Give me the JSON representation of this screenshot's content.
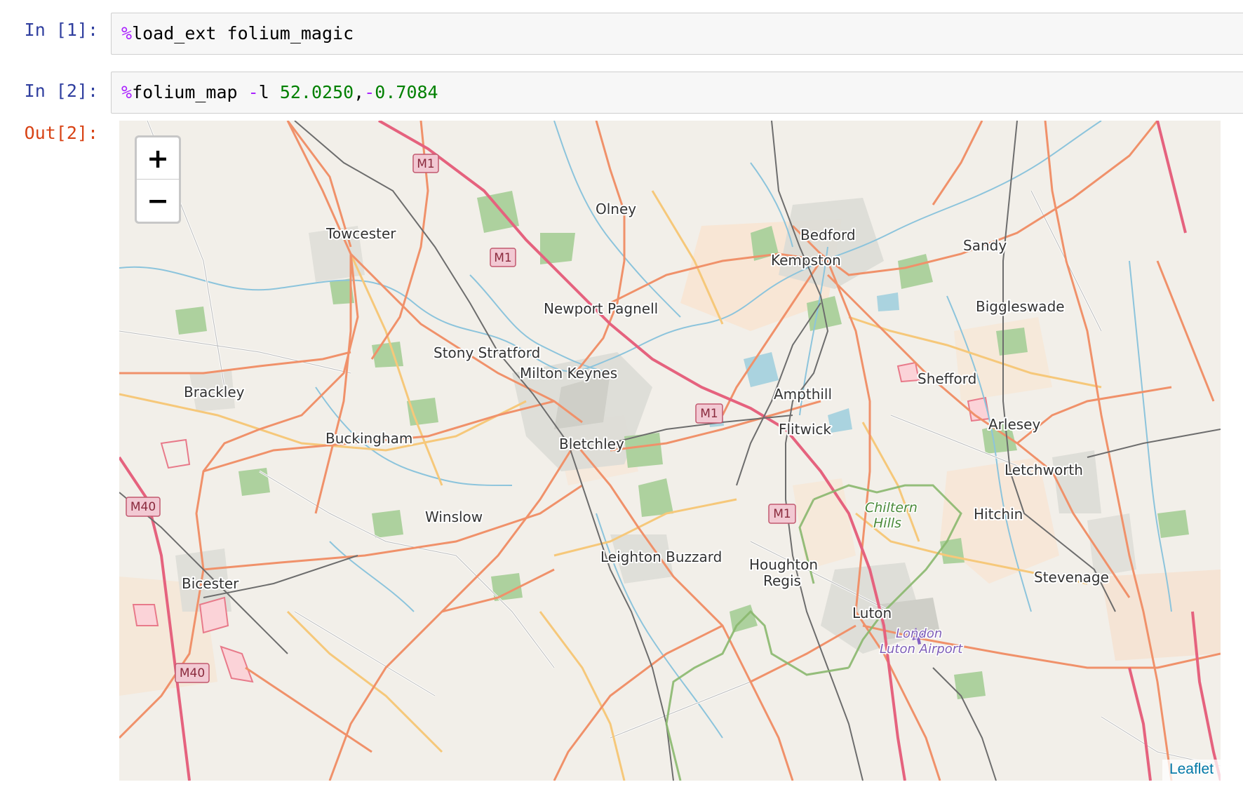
{
  "cells": [
    {
      "prompt": "In [1]:",
      "magic": "%",
      "code": "load_ext folium_magic"
    },
    {
      "prompt": "In [2]:",
      "magic": "%",
      "code_name": "folium_map ",
      "flag_op": "-",
      "flag": "l ",
      "lat": "52.0250",
      "comma": ",",
      "neg": "-",
      "lon": "0.7084"
    }
  ],
  "output": {
    "prompt": "Out[2]:"
  },
  "map": {
    "zoom_in_label": "+",
    "zoom_out_label": "−",
    "attribution": "Leaflet",
    "places": {
      "towcester": "Towcester",
      "olney": "Olney",
      "bedford": "Bedford",
      "kempston": "Kempston",
      "sandy": "Sandy",
      "biggleswade": "Biggleswade",
      "newport_pagnell": "Newport Pagnell",
      "stony_stratford": "Stony Stratford",
      "milton_keynes": "Milton Keynes",
      "brackley": "Brackley",
      "ampthill": "Ampthill",
      "shefford": "Shefford",
      "buckingham": "Buckingham",
      "bletchley": "Bletchley",
      "flitwick": "Flitwick",
      "arlesey": "Arlesey",
      "letchworth": "Letchworth",
      "winslow": "Winslow",
      "hitchin": "Hitchin",
      "chiltern1": "Chiltern",
      "chiltern2": "Hills",
      "leighton_buzzard": "Leighton Buzzard",
      "houghton1": "Houghton",
      "houghton2": "Regis",
      "bicester": "Bicester",
      "stevenage": "Stevenage",
      "luton": "Luton",
      "airport1": "London",
      "airport2": "Luton Airport"
    },
    "shields": {
      "m1": "M1",
      "m40": "M40"
    }
  }
}
